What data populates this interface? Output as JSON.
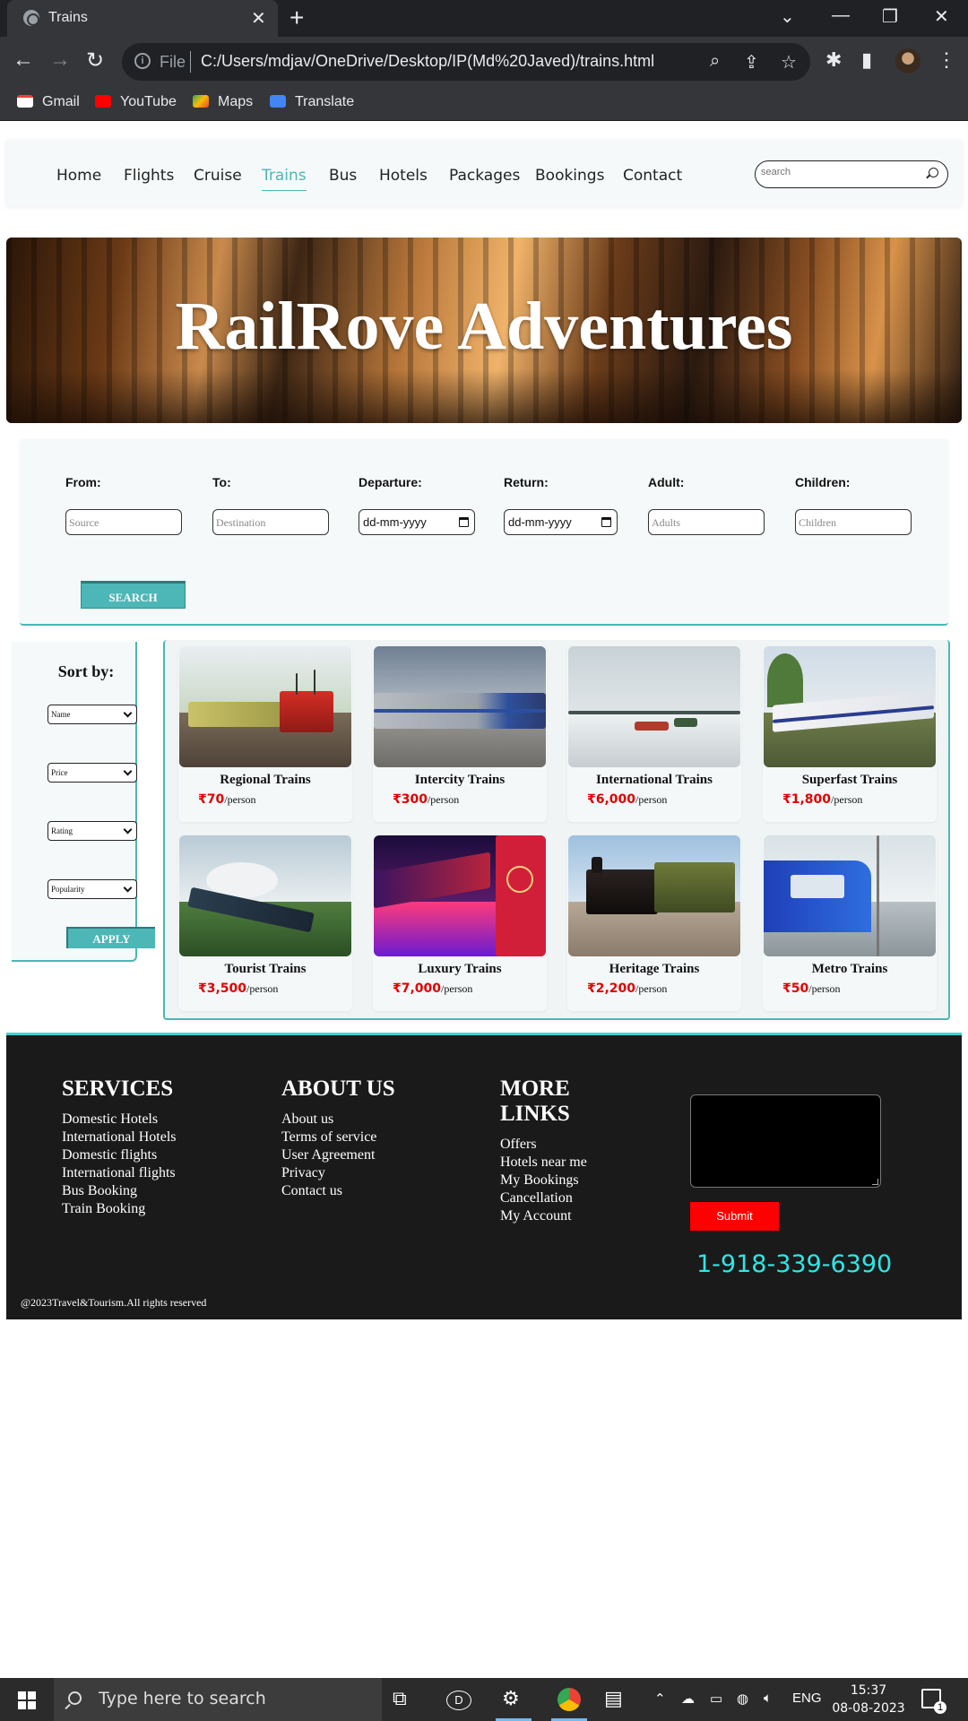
{
  "browser": {
    "tab_title": "Trains",
    "address_prefix": "File",
    "url": "C:/Users/mdjav/OneDrive/Desktop/IP(Md%20Javed)/trains.html",
    "bookmarks": [
      {
        "label": "Gmail"
      },
      {
        "label": "YouTube"
      },
      {
        "label": "Maps"
      },
      {
        "label": "Translate"
      }
    ]
  },
  "nav": {
    "links": [
      "Home",
      "Flights",
      "Cruise",
      "Trains",
      "Bus",
      "Hotels",
      "Packages",
      "Bookings",
      "Contact"
    ],
    "active": "Trains",
    "search_placeholder": "search"
  },
  "hero": {
    "title": "RailRove Adventures"
  },
  "booking": {
    "fields": [
      {
        "label": "From:",
        "placeholder": "Source"
      },
      {
        "label": "To:",
        "placeholder": "Destination"
      },
      {
        "label": "Departure:",
        "placeholder": "dd-mm-yyyy"
      },
      {
        "label": "Return:",
        "placeholder": "dd-mm-yyyy"
      },
      {
        "label": "Adult:",
        "placeholder": "Adults"
      },
      {
        "label": "Children:",
        "placeholder": "Children"
      }
    ],
    "search_label": "SEARCH"
  },
  "sort": {
    "title": "Sort by:",
    "selects": [
      "Name",
      "Price",
      "Rating",
      "Popularity"
    ],
    "apply_label": "APPLY"
  },
  "products": [
    {
      "name": "Regional Trains",
      "price": "₹70",
      "unit": "/person"
    },
    {
      "name": "Intercity Trains",
      "price": "₹300",
      "unit": "/person"
    },
    {
      "name": "International Trains",
      "price": "₹6,000",
      "unit": "/person"
    },
    {
      "name": "Superfast Trains",
      "price": "₹1,800",
      "unit": "/person"
    },
    {
      "name": "Tourist Trains",
      "price": "₹3,500",
      "unit": "/person"
    },
    {
      "name": "Luxury Trains",
      "price": "₹7,000",
      "unit": "/person"
    },
    {
      "name": "Heritage Trains",
      "price": "₹2,200",
      "unit": "/person"
    },
    {
      "name": "Metro Trains",
      "price": "₹50",
      "unit": "/person"
    }
  ],
  "footer": {
    "services": {
      "title": "SERVICES",
      "links": [
        "Domestic Hotels",
        "International Hotels",
        "Domestic flights",
        "International flights",
        "Bus Booking",
        "Train Booking"
      ]
    },
    "about": {
      "title": "ABOUT US",
      "links": [
        "About us",
        "Terms of service",
        "User Agreement",
        "Privacy",
        "Contact us"
      ]
    },
    "more": {
      "title_line1": "MORE",
      "title_line2": "LINKS",
      "links": [
        "Offers",
        "Hotels near me",
        "My Bookings",
        "Cancellation",
        "My Account"
      ]
    },
    "submit_label": "Submit",
    "phone": "1-918-339-6390",
    "copyright": "@2023Travel&Tourism.All rights reserved"
  },
  "taskbar": {
    "search_text": "Type here to search",
    "language": "ENG",
    "time": "15:37",
    "date": "08-08-2023",
    "notifications": "1"
  },
  "colors": {
    "accent": "#4db6b6",
    "price": "#e00000",
    "footer_bg": "#1a1a1a",
    "phone": "#2ee6e6",
    "submit": "#ff0000"
  }
}
